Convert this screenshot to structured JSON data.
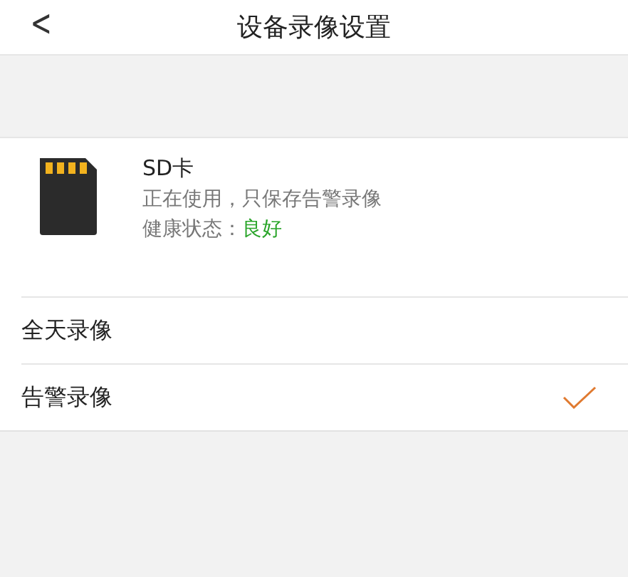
{
  "header": {
    "back_icon": "<",
    "title": "设备录像设置"
  },
  "storage": {
    "name": "SD卡",
    "usage": "正在使用，只保存告警录像",
    "health_label": "健康状态：",
    "health_value": "良好"
  },
  "options": [
    {
      "label": "全天录像",
      "selected": false
    },
    {
      "label": "告警录像",
      "selected": true
    }
  ]
}
